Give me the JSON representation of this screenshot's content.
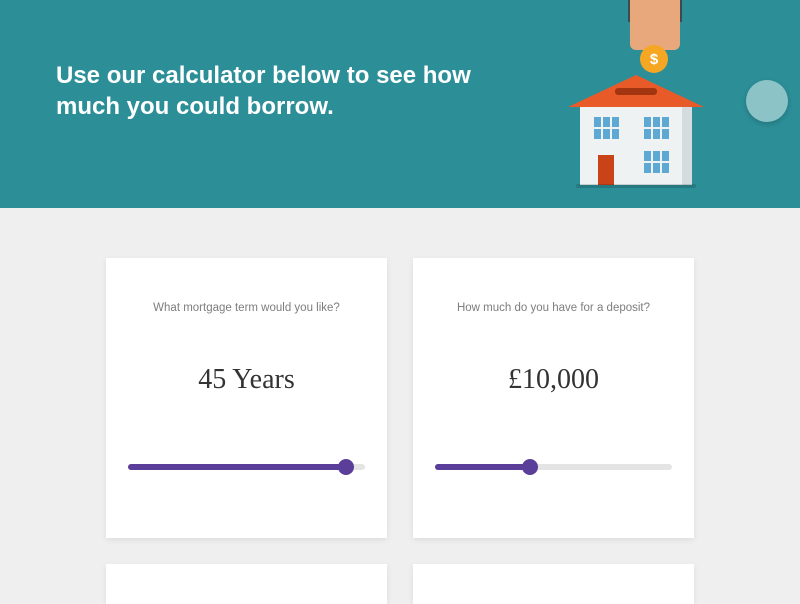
{
  "hero": {
    "title": "Use our calculator below to see how much you could borrow."
  },
  "coin_symbol": "$",
  "cards": {
    "term": {
      "label": "What mortgage term would you like?",
      "value": "45 Years",
      "slider_percent": 92
    },
    "deposit": {
      "label": "How much do you have for a deposit?",
      "value": "£10,000",
      "slider_percent": 40
    }
  }
}
